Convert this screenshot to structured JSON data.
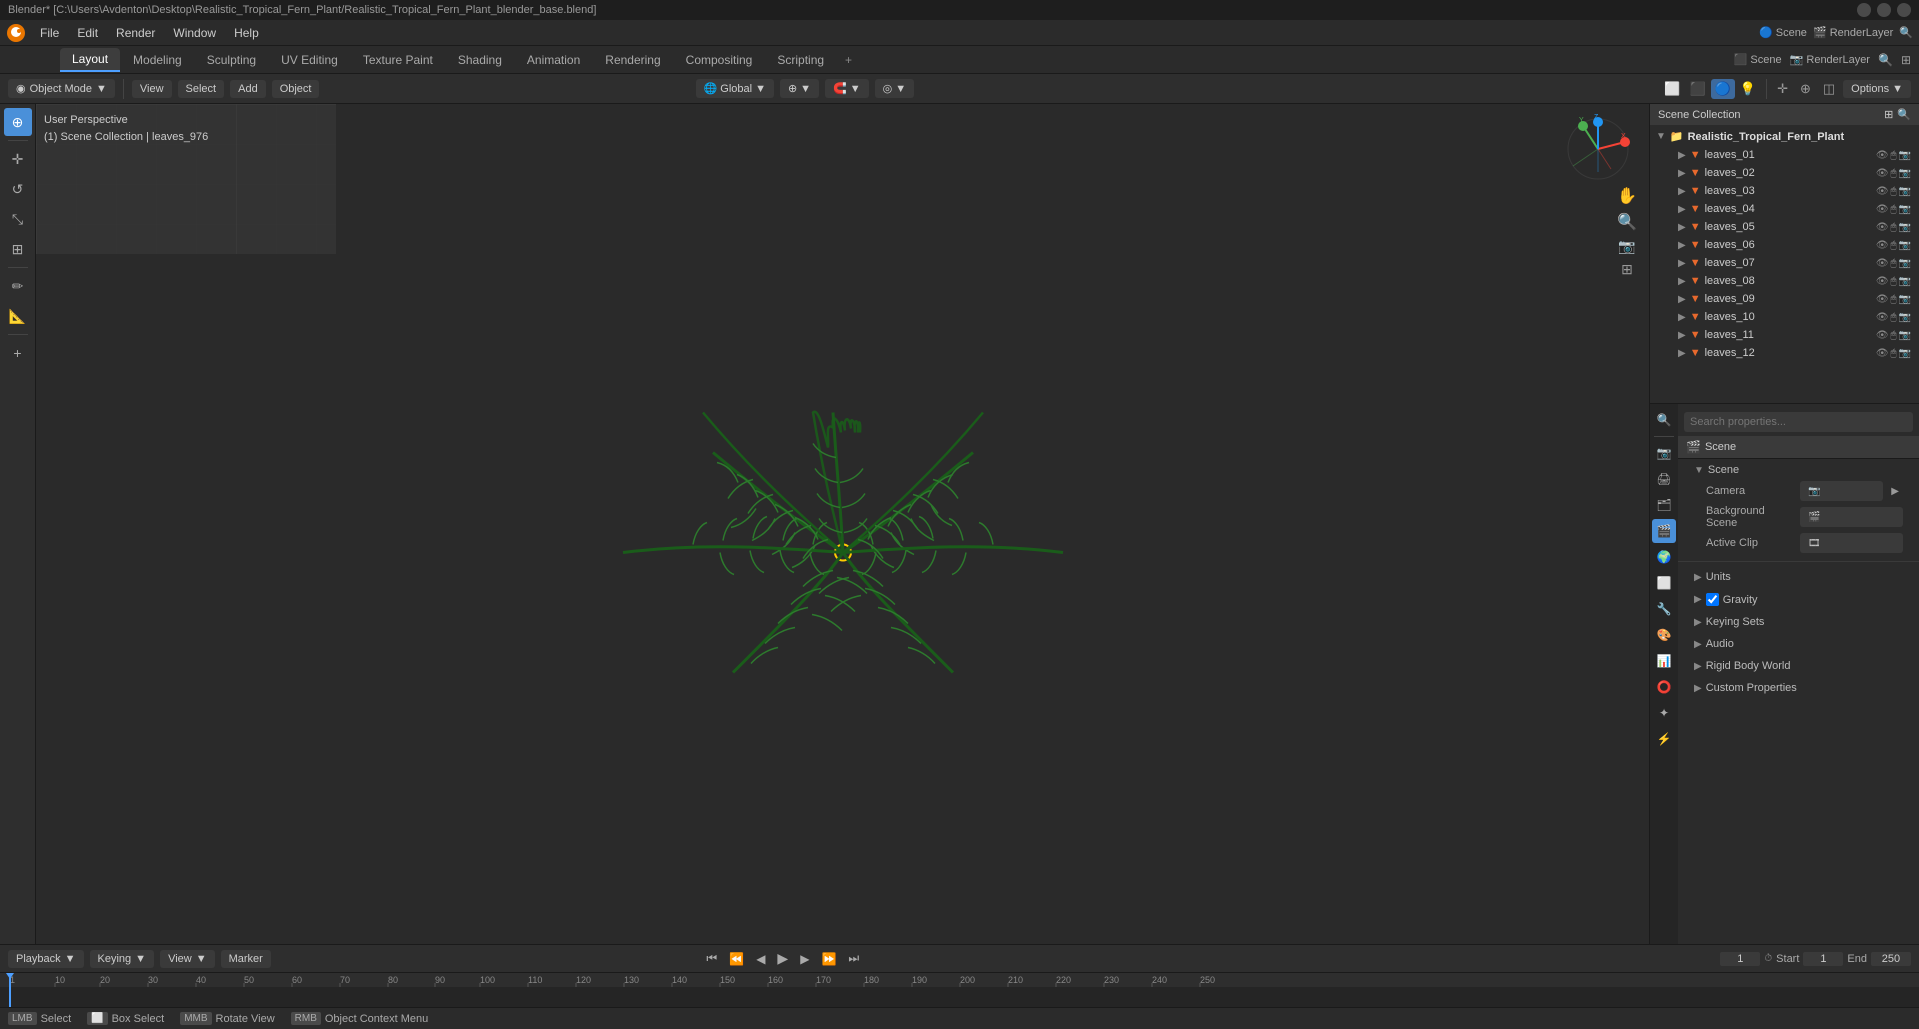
{
  "window": {
    "title": "Blender* [C:\\Users\\Avdenton\\Desktop\\Realistic_Tropical_Fern_Plant/Realistic_Tropical_Fern_Plant_blender_base.blend]",
    "controls": [
      "minimize",
      "maximize",
      "close"
    ]
  },
  "menu": {
    "items": [
      "Blender",
      "File",
      "Edit",
      "Render",
      "Window",
      "Help"
    ]
  },
  "workspace_tabs": {
    "tabs": [
      "Layout",
      "Modeling",
      "Sculpting",
      "UV Editing",
      "Texture Paint",
      "Shading",
      "Animation",
      "Rendering",
      "Compositing",
      "Scripting"
    ],
    "active": "Layout",
    "add_label": "+"
  },
  "toolbar": {
    "mode_label": "Object Mode",
    "view_label": "View",
    "select_label": "Select",
    "add_label": "Add",
    "object_label": "Object",
    "global_label": "Global",
    "options_label": "Options"
  },
  "viewport": {
    "info_line1": "User Perspective",
    "info_line2": "(1) Scene Collection | leaves_976"
  },
  "left_tools": {
    "tools": [
      "cursor",
      "move",
      "rotate",
      "scale",
      "transform",
      "annotate",
      "measure"
    ]
  },
  "outliner": {
    "title": "Scene Collection",
    "search_placeholder": "Search",
    "items": [
      {
        "name": "Realistic_Tropical_Fern_Plant",
        "depth": 0,
        "type": "collection"
      },
      {
        "name": "leaves_01",
        "depth": 1,
        "type": "mesh"
      },
      {
        "name": "leaves_02",
        "depth": 1,
        "type": "mesh"
      },
      {
        "name": "leaves_03",
        "depth": 1,
        "type": "mesh"
      },
      {
        "name": "leaves_04",
        "depth": 1,
        "type": "mesh"
      },
      {
        "name": "leaves_05",
        "depth": 1,
        "type": "mesh"
      },
      {
        "name": "leaves_06",
        "depth": 1,
        "type": "mesh"
      },
      {
        "name": "leaves_07",
        "depth": 1,
        "type": "mesh"
      },
      {
        "name": "leaves_08",
        "depth": 1,
        "type": "mesh"
      },
      {
        "name": "leaves_09",
        "depth": 1,
        "type": "mesh"
      },
      {
        "name": "leaves_10",
        "depth": 1,
        "type": "mesh"
      },
      {
        "name": "leaves_11",
        "depth": 1,
        "type": "mesh"
      },
      {
        "name": "leaves_12",
        "depth": 1,
        "type": "mesh"
      }
    ]
  },
  "properties": {
    "active_tab": "scene",
    "tabs": [
      "render",
      "output",
      "view_layer",
      "scene",
      "world",
      "object",
      "particles",
      "physics",
      "constraints",
      "modifiers",
      "shader",
      "data",
      "material"
    ],
    "scene_label": "Scene",
    "sections": {
      "scene": {
        "title": "Scene",
        "camera_label": "Camera",
        "background_scene_label": "Background Scene",
        "active_clip_label": "Active Clip"
      },
      "units": {
        "title": "Units"
      },
      "gravity": {
        "title": "Gravity",
        "checked": true
      },
      "keying_sets": {
        "title": "Keying Sets"
      },
      "audio": {
        "title": "Audio"
      },
      "rigid_body_world": {
        "title": "Rigid Body World"
      },
      "custom_properties": {
        "title": "Custom Properties"
      }
    }
  },
  "timeline": {
    "playback_label": "Playback",
    "keying_label": "Keying",
    "view_label": "View",
    "marker_label": "Marker",
    "current_frame": "1",
    "start_frame": "1",
    "end_frame": "250",
    "start_label": "Start",
    "end_label": "End",
    "ticks": [
      "1",
      "10",
      "20",
      "30",
      "40",
      "50",
      "60",
      "70",
      "80",
      "90",
      "100",
      "110",
      "120",
      "130",
      "140",
      "150",
      "160",
      "170",
      "180",
      "190",
      "200",
      "210",
      "220",
      "230",
      "240",
      "250"
    ]
  },
  "status_bar": {
    "select_label": "Select",
    "box_select_label": "Box Select",
    "rotate_view_label": "Rotate View",
    "object_context_label": "Object Context Menu"
  },
  "colors": {
    "accent": "#4d9fff",
    "active_tab_bg": "#3d3d3d",
    "panel_bg": "#2b2b2b",
    "toolbar_bg": "#2e2e2e",
    "dark_bg": "#1a1a1a",
    "red_axis": "#cc3333",
    "green_axis": "#33cc33",
    "blue_axis": "#3366cc",
    "fern_green": "#2d7a2d"
  }
}
